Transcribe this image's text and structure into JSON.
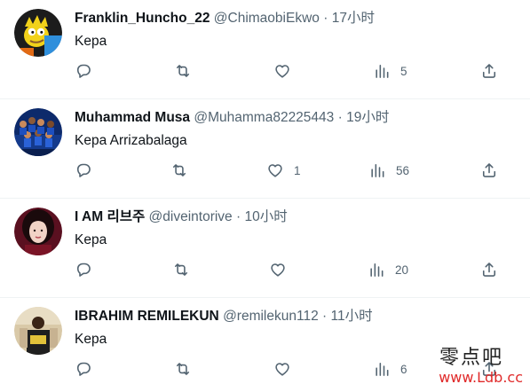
{
  "replies": [
    {
      "name": "Franklin_Huncho_22",
      "handle": "@ChimaobiEkwo",
      "separator": "·",
      "time": "17小时",
      "text": "Kepa",
      "counts": {
        "reply": "",
        "retweet": "",
        "like": "",
        "views": "5"
      }
    },
    {
      "name": "Muhammad Musa",
      "handle": "@Muhamma82225443",
      "separator": "·",
      "time": "19小时",
      "text": "Kepa Arrizabalaga",
      "counts": {
        "reply": "",
        "retweet": "",
        "like": "1",
        "views": "56"
      }
    },
    {
      "name": "I AM 리브주",
      "handle": "@diveintorive",
      "separator": "·",
      "time": "10小时",
      "text": "Kepa",
      "counts": {
        "reply": "",
        "retweet": "",
        "like": "",
        "views": "20"
      }
    },
    {
      "name": "IBRAHIM REMILEKUN",
      "handle": "@remilekun112",
      "separator": "·",
      "time": "11小时",
      "text": "Kepa",
      "counts": {
        "reply": "",
        "retweet": "",
        "like": "",
        "views": "6"
      }
    }
  ],
  "watermark": {
    "line1": "零点吧",
    "line2": "www.Ldb.cc"
  },
  "icons": [
    "reply-icon",
    "retweet-icon",
    "like-icon",
    "views-icon",
    "share-icon"
  ],
  "colors": {
    "text": "#0f1419",
    "secondary": "#536471",
    "divider": "#eff3f4",
    "watermark_red": "#e02a2a"
  }
}
